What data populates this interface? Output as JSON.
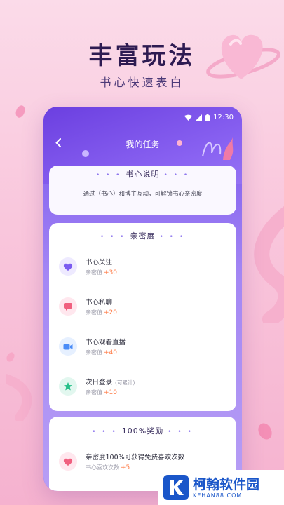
{
  "hero": {
    "title": "丰富玩法",
    "subtitle": "书心快速表白"
  },
  "status_bar": {
    "time": "12:30"
  },
  "nav": {
    "title": "我的任务"
  },
  "info_card": {
    "title": "书心说明",
    "text": "通过（书心）和博主互动，可解锁书心亲密度"
  },
  "task_card": {
    "title": "亲密度",
    "items": [
      {
        "name": "书心关注",
        "sub": "亲密值",
        "points": "+30",
        "extra": "",
        "icon": "heart-icon",
        "icon_color": "#7b5cf0"
      },
      {
        "name": "书心私聊",
        "sub": "亲密值",
        "points": "+20",
        "extra": "",
        "icon": "chat-icon",
        "icon_color": "#f0607f"
      },
      {
        "name": "书心观看直播",
        "sub": "亲密值",
        "points": "+40",
        "extra": "",
        "icon": "video-icon",
        "icon_color": "#4a8cf7"
      },
      {
        "name": "次日登录",
        "sub": "亲密值",
        "points": "+10",
        "extra": "(可累计)",
        "icon": "star-icon",
        "icon_color": "#29c08a"
      }
    ]
  },
  "reward_card": {
    "title": "100%奖励",
    "item": {
      "name": "亲密度100%可获得免费喜欢次数",
      "sub": "书心喜欢次数",
      "points": "+5",
      "icon": "heart-icon",
      "icon_color": "#f0607f"
    }
  },
  "watermark": {
    "name": "柯翰软件园",
    "domain": "KEHAN88.COM"
  },
  "colors": {
    "accent": "#7b59e6",
    "points": "#ff7a45",
    "title": "#2e1b52"
  }
}
